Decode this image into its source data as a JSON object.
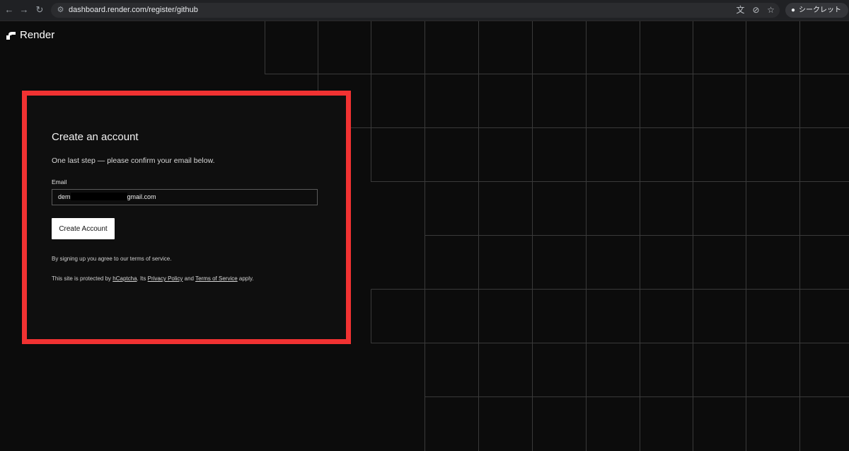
{
  "browser": {
    "url": "dashboard.render.com/register/github",
    "profile_label": "シークレット"
  },
  "brand": {
    "name": "Render"
  },
  "form": {
    "title": "Create an account",
    "subtitle": "One last step — please confirm your email below.",
    "email_label": "Email",
    "email_prefix": "dem",
    "email_suffix": "gmail.com",
    "submit_label": "Create Account",
    "terms_note": "By signing up you agree to our terms of service.",
    "captcha": {
      "prefix": "This site is protected by ",
      "hcaptcha_link": "hCaptcha",
      "middle": ". Its ",
      "privacy_link": "Privacy Policy",
      "and": " and ",
      "terms_link": "Terms of Service",
      "suffix": " apply."
    }
  },
  "colors": {
    "background": "#0c0c0c",
    "highlight_border": "#f13232",
    "button_bg": "#ffffff",
    "grid_line": "#3a3a3a"
  }
}
